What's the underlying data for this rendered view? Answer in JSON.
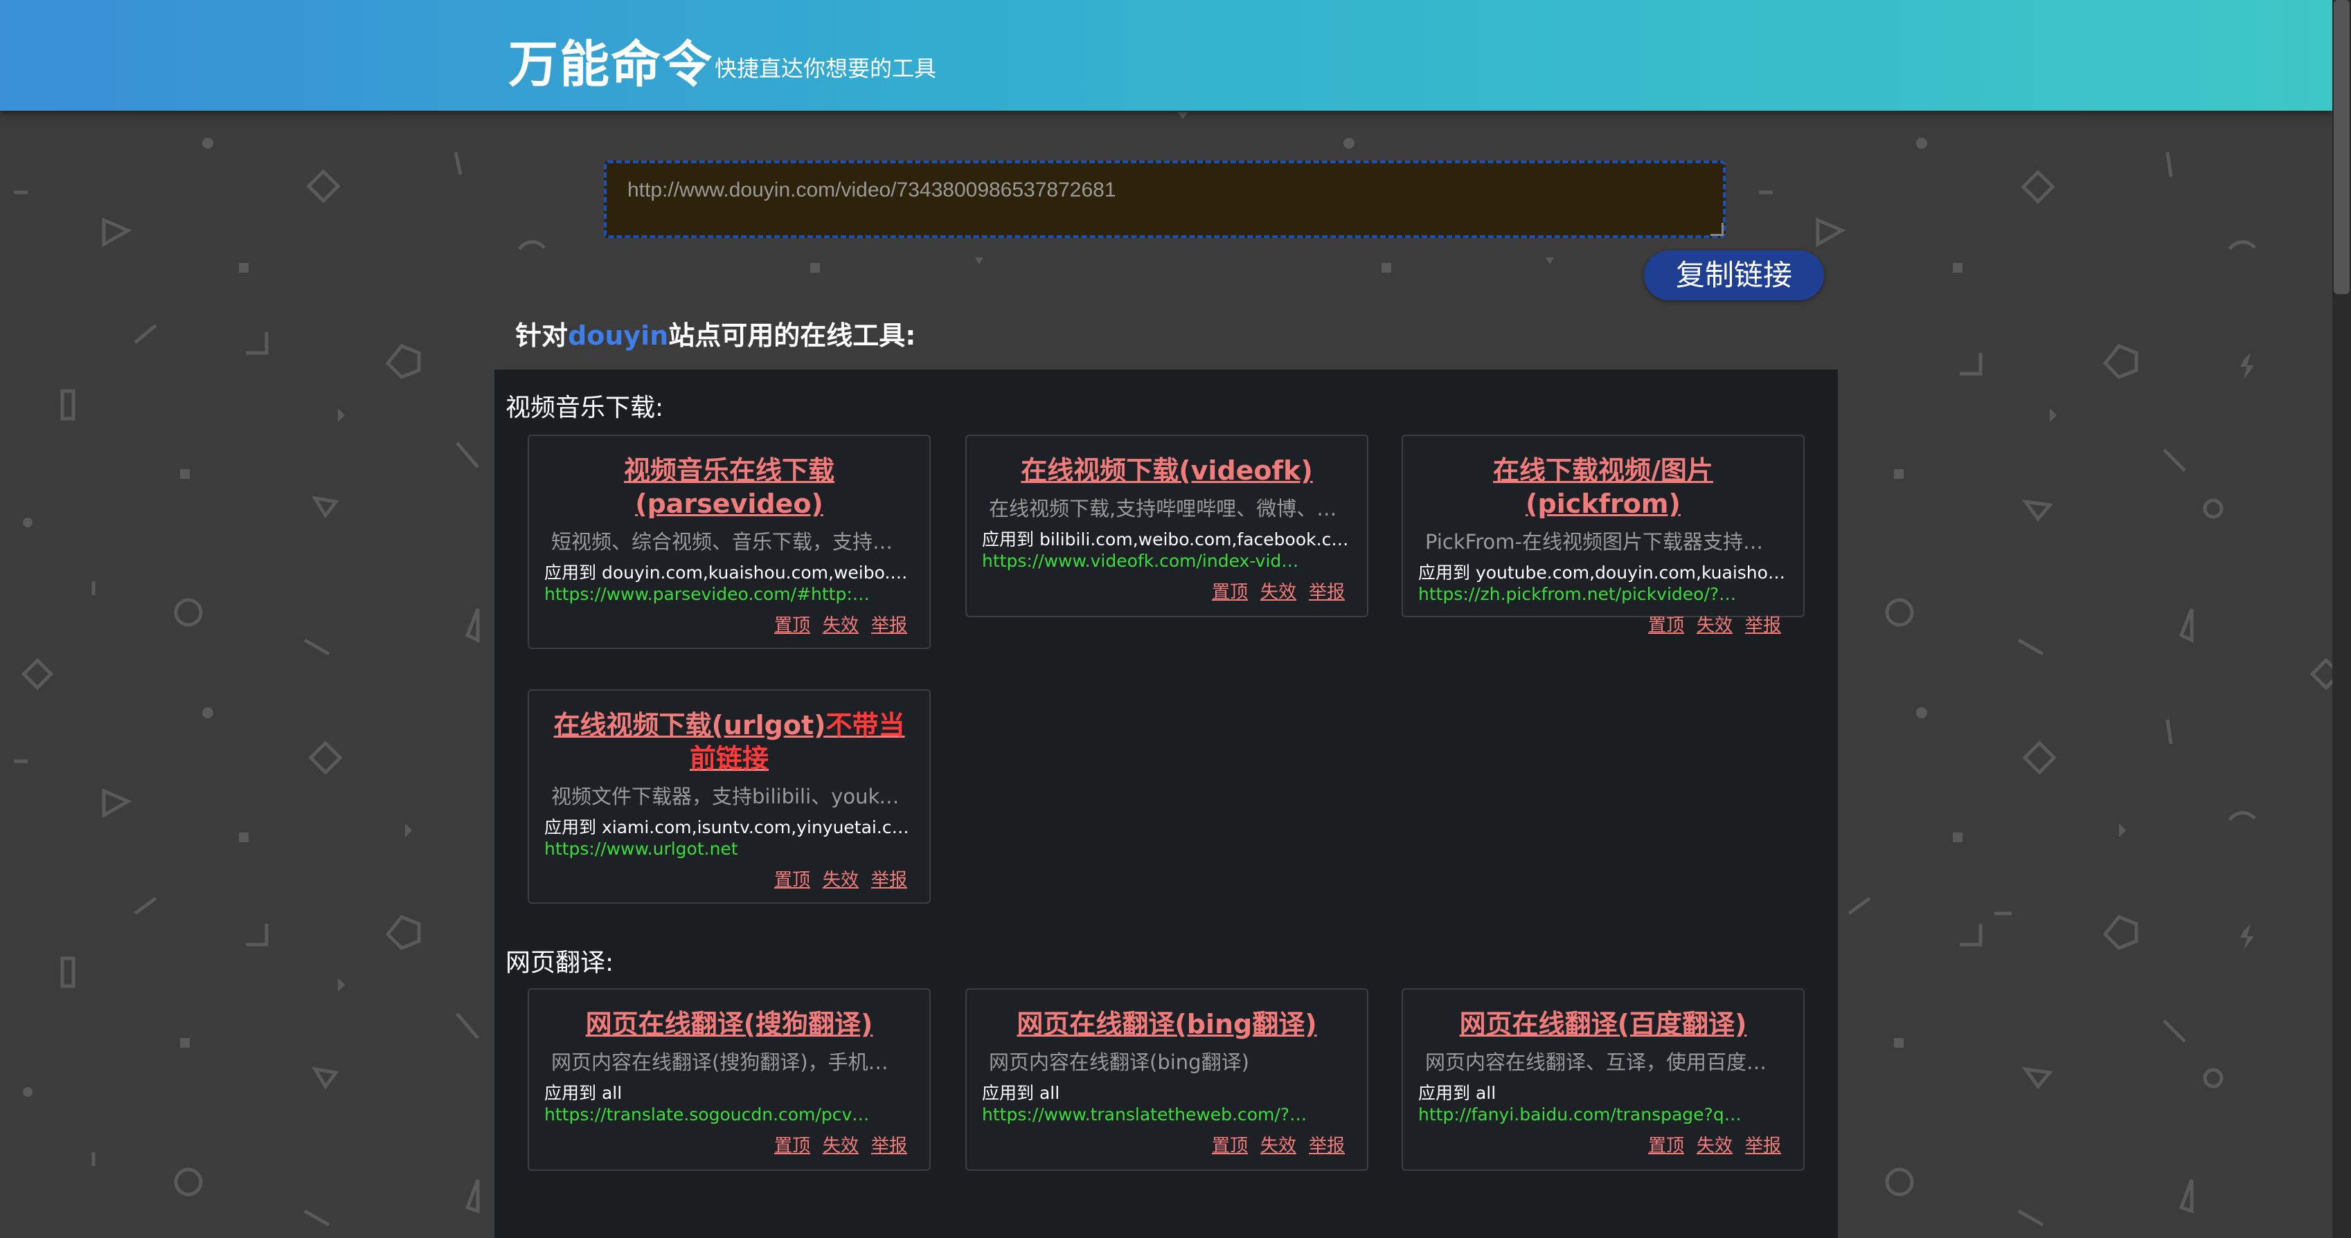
{
  "header": {
    "brand": "万能命令",
    "tagline": "快捷直达你想要的工具"
  },
  "url_input": {
    "value": "http://www.douyin.com/video/7343800986537872681"
  },
  "copy_button": {
    "label": "复制链接"
  },
  "site_heading": {
    "prefix": "针对",
    "site": "douyin",
    "suffix": "站点可用的在线工具:"
  },
  "actions": {
    "pin": "置顶",
    "invalid": "失效",
    "report": "举报"
  },
  "sections": [
    {
      "title": "视频音乐下载:",
      "cards": [
        {
          "title": "视频音乐在线下载(parsevideo)",
          "warning": "",
          "desc": "短视频、综合视频、音乐下载，支持抖音、快手、微博等",
          "applies": "应用到 douyin.com,kuaishou.com,weibo.com…",
          "url": "https://www.parsevideo.com/#http:…"
        },
        {
          "title": "在线视频下载(videofk)",
          "warning": "",
          "desc": "在线视频下载,支持哔哩哔哩、微博、梨视频等",
          "applies": "应用到 bilibili.com,weibo.com,facebook.com,…",
          "url": "https://www.videofk.com/index-vid…"
        },
        {
          "title": "在线下载视频/图片(pickfrom)",
          "warning": "",
          "desc": "PickFrom-在线视频图片下载器支持下载",
          "applies": "应用到 youtube.com,douyin.com,kuaishou.co…",
          "url": "https://zh.pickfrom.net/pickvideo/?…"
        },
        {
          "title": "在线视频下载(urlgot)",
          "warning": "不带当前链接",
          "desc": "视频文件下载器，支持bilibili、youku等",
          "applies": "应用到 xiami.com,isuntv.com,yinyuetai.com,y…",
          "url": "https://www.urlgot.net"
        }
      ]
    },
    {
      "title": "网页翻译:",
      "cards": [
        {
          "title": "网页在线翻译(搜狗翻译)",
          "warning": "",
          "desc": "网页内容在线翻译(搜狗翻译)，手机端可用",
          "applies": "应用到 all",
          "url": "https://translate.sogoucdn.com/pcv…"
        },
        {
          "title": "网页在线翻译(bing翻译)",
          "warning": "",
          "desc": "网页内容在线翻译(bing翻译)",
          "applies": "应用到 all",
          "url": "https://www.translatetheweb.com/?…"
        },
        {
          "title": "网页在线翻译(百度翻译)",
          "warning": "",
          "desc": "网页内容在线翻译、互译，使用百度翻译",
          "applies": "应用到 all",
          "url": "http://fanyi.baidu.com/transpage?q…"
        }
      ]
    }
  ]
}
